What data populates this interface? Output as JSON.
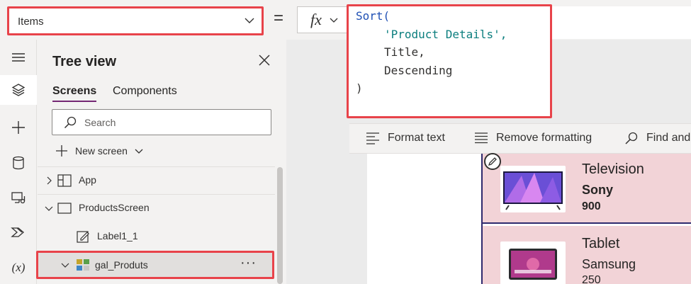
{
  "formula_bar": {
    "property": "Items",
    "equals": "=",
    "fx": "fx",
    "formula": {
      "line1_fn": "Sort(",
      "line2": "'Product Details',",
      "line3": "Title,",
      "line4": "Descending",
      "line5": ")"
    }
  },
  "rail": {
    "items": [
      "menu-icon",
      "layers-icon",
      "plus-icon",
      "database-icon",
      "media-icon",
      "power-automate-icon"
    ],
    "variables_label": "(x)"
  },
  "tree": {
    "title": "Tree view",
    "tabs": [
      "Screens",
      "Components"
    ],
    "search_placeholder": "Search",
    "new_screen": "New screen",
    "nodes": {
      "app": "App",
      "products_screen": "ProductsScreen",
      "label": "Label1_1",
      "gallery": "gal_Produts",
      "more": "···"
    }
  },
  "toolbar": {
    "format_text": "Format text",
    "remove_formatting": "Remove formatting",
    "find": "Find and"
  },
  "gallery": {
    "items": [
      {
        "title": "Television",
        "brand": "Sony",
        "price": "900"
      },
      {
        "title": "Tablet",
        "brand": "Samsung",
        "price": "250"
      }
    ]
  },
  "colors": {
    "highlight_red": "#e8434a",
    "tab_underline": "#742774",
    "gallery_bg": "#f2d3d7",
    "gallery_border": "#2f2a6e"
  }
}
